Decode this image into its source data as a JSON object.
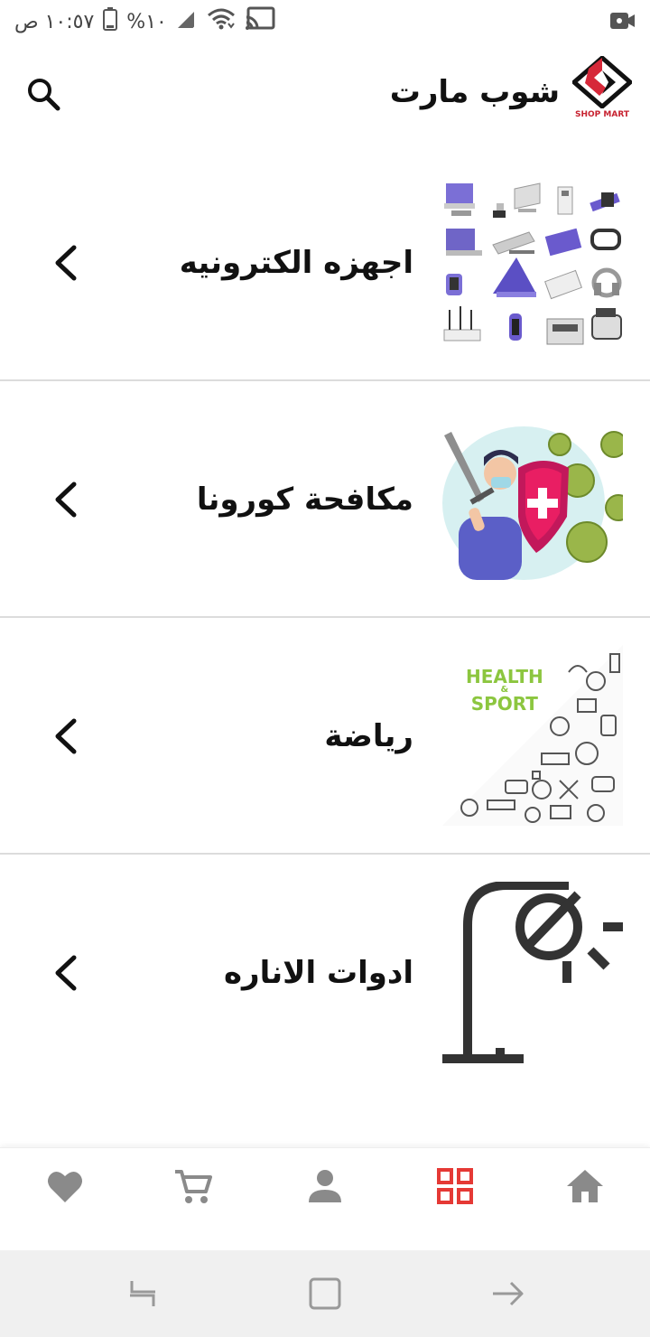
{
  "status_bar": {
    "time": "١٠:٥٧ ص",
    "battery": "١٠%",
    "icons": [
      "battery-icon",
      "signal-icon",
      "wifi-icon",
      "cast-icon",
      "video-recording-icon"
    ]
  },
  "header": {
    "title": "شوب مارت",
    "logo_text": "SHOP MART",
    "search_icon": "search-icon"
  },
  "categories": [
    {
      "label": "اجهزه الكترونيه",
      "image": "electronics-devices-image",
      "icon": "chevron-left-icon"
    },
    {
      "label": "مكافحة كورونا",
      "image": "anti-corona-illustration",
      "icon": "chevron-left-icon"
    },
    {
      "label": "رياضة",
      "image": "health-sport-illustration",
      "icon": "chevron-left-icon"
    },
    {
      "label": "ادوات الاناره",
      "image": "street-lamp-icon",
      "icon": "chevron-left-icon"
    }
  ],
  "sport_image_text": {
    "line1": "HEALTH",
    "amp": "&",
    "line2": "SPORT"
  },
  "bottom_nav": [
    {
      "name": "favorites",
      "icon": "heart-icon",
      "active": false
    },
    {
      "name": "cart",
      "icon": "cart-icon",
      "active": false
    },
    {
      "name": "profile",
      "icon": "person-icon",
      "active": false
    },
    {
      "name": "categories",
      "icon": "grid-icon",
      "active": true
    },
    {
      "name": "home",
      "icon": "home-icon",
      "active": false
    }
  ],
  "colors": {
    "accent": "#e53935",
    "nav_inactive": "#8a8a8a",
    "brand_red": "#c7212f",
    "divider": "#dcdcdc",
    "system_nav_bg": "#f0f0f0"
  }
}
